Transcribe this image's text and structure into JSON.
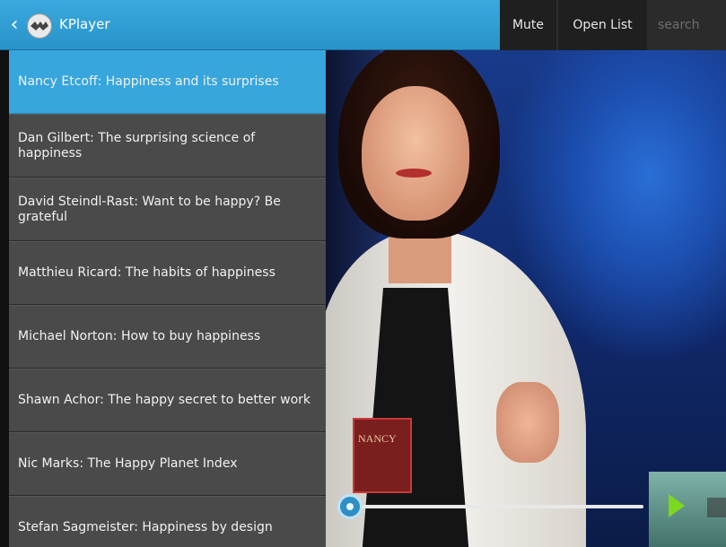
{
  "appbar": {
    "title": "KPlayer",
    "mute_label": "Mute",
    "open_list_label": "Open List",
    "search_placeholder": "search"
  },
  "playlist": {
    "items": [
      {
        "label": "Nancy Etcoff: Happiness and its surprises",
        "active": true
      },
      {
        "label": "Dan Gilbert: The surprising science of happiness"
      },
      {
        "label": "David Steindl-Rast: Want to be happy? Be grateful"
      },
      {
        "label": "Matthieu Ricard: The habits of happiness"
      },
      {
        "label": "Michael Norton: How to buy happiness"
      },
      {
        "label": "Shawn Achor: The happy secret to better work"
      },
      {
        "label": "Nic Marks: The Happy Planet Index"
      },
      {
        "label": "Stefan Sagmeister: Happiness by design"
      }
    ]
  },
  "player": {
    "progress": 0.04
  },
  "badge_text": "NANCY",
  "colors": {
    "accent": "#36a6dd",
    "play": "#7bd81e",
    "action_bar_dark": "#1f1f1f"
  },
  "icons": {
    "back": "chevron-left-icon",
    "logo": "kplayer-logo-icon",
    "play": "play-icon"
  }
}
